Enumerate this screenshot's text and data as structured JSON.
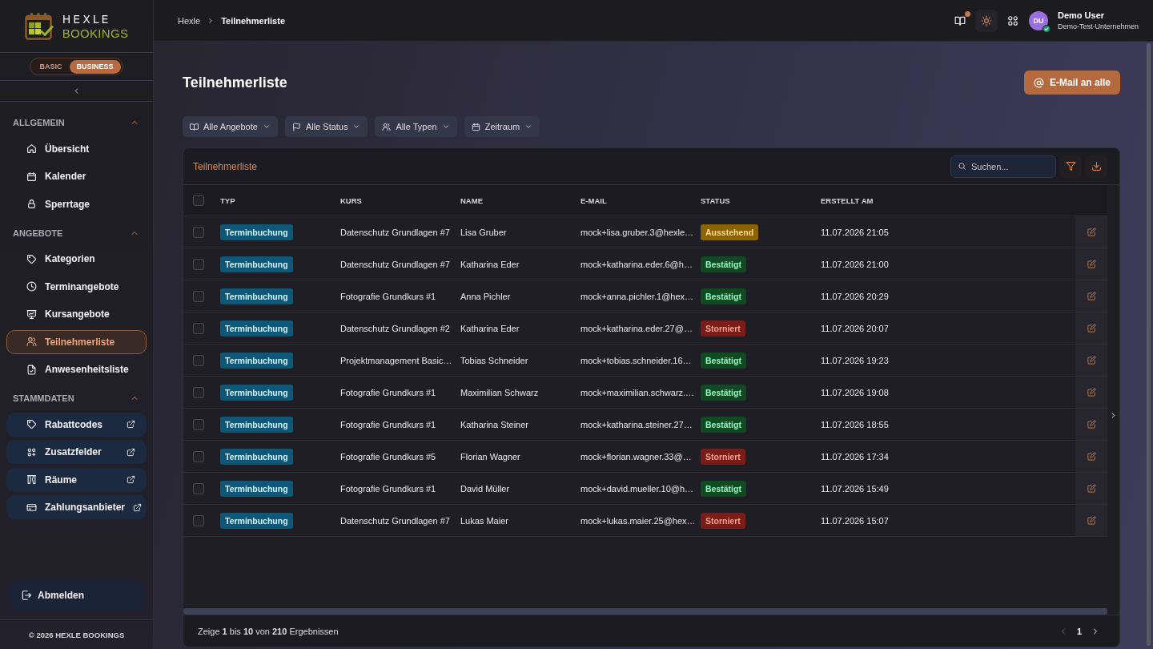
{
  "sidebar": {
    "logo": {
      "name": "HEXLE",
      "subtitle": "BOOKINGS"
    },
    "plans": [
      {
        "label": "BASIC",
        "selected": false
      },
      {
        "label": "BUSINESS",
        "selected": true
      }
    ],
    "sections": [
      {
        "title": "ALLGEMEIN",
        "expanded": true,
        "items": [
          {
            "label": "Übersicht",
            "kind": "page",
            "selected": false
          },
          {
            "label": "Kalender",
            "kind": "page",
            "selected": false
          },
          {
            "label": "Sperrtage",
            "kind": "page",
            "selected": false
          }
        ]
      },
      {
        "title": "ANGEBOTE",
        "expanded": true,
        "items": [
          {
            "label": "Kategorien",
            "kind": "page",
            "selected": false
          },
          {
            "label": "Terminangebote",
            "kind": "page",
            "selected": false
          },
          {
            "label": "Kursangebote",
            "kind": "page",
            "selected": false
          },
          {
            "label": "Teilnehmerliste",
            "kind": "page",
            "selected": true
          },
          {
            "label": "Anwesenheitsliste",
            "kind": "page",
            "selected": false
          }
        ]
      },
      {
        "title": "STAMMDATEN",
        "expanded": true,
        "items": [
          {
            "label": "Rabattcodes",
            "kind": "external",
            "selected": false
          },
          {
            "label": "Zusatzfelder",
            "kind": "external",
            "selected": false
          },
          {
            "label": "Räume",
            "kind": "external",
            "selected": false
          },
          {
            "label": "Zahlungsanbieter",
            "kind": "external",
            "selected": false
          }
        ]
      }
    ],
    "logout": "Abmelden",
    "copyright": "© 2026 HEXLE BOOKINGS"
  },
  "topbar": {
    "breadcrumb": [
      {
        "label": "Hexle",
        "current": false
      },
      {
        "label": "Teilnehmerliste",
        "current": true
      }
    ],
    "docs_badge": true,
    "theme_active": true,
    "user": {
      "initials": "DU",
      "name": "Demo User",
      "company": "Demo-Test-Unternehmen",
      "verified": true
    }
  },
  "page": {
    "title": "Teilnehmerliste",
    "action": "E-Mail an alle",
    "filters": [
      {
        "label": "Alle Angebote"
      },
      {
        "label": "Alle Status"
      },
      {
        "label": "Alle Typen"
      },
      {
        "label": "Zeitraum"
      }
    ]
  },
  "table": {
    "title": "Teilnehmerliste",
    "search": {
      "placeholder": "Suchen..."
    },
    "all_checked": false,
    "columns": [
      "TYP",
      "KURS",
      "NAME",
      "E-MAIL",
      "STATUS",
      "ERSTELLT AM"
    ],
    "rows": [
      {
        "checked": false,
        "type": "Terminbuchung",
        "course": "Datenschutz Grundlagen #7",
        "name": "Lisa Gruber",
        "email": "mock+lisa.gruber.3@hexle…",
        "status": {
          "label": "Ausstehend",
          "color": "#8d6300"
        },
        "created": "11.07.2026 21:05"
      },
      {
        "checked": false,
        "type": "Terminbuchung",
        "course": "Datenschutz Grundlagen #7",
        "name": "Katharina Eder",
        "email": "mock+katharina.eder.6@h…",
        "status": {
          "label": "Bestätigt",
          "color": "#0f4a25"
        },
        "created": "11.07.2026 21:00"
      },
      {
        "checked": false,
        "type": "Terminbuchung",
        "course": "Fotografie Grundkurs #1",
        "name": "Anna Pichler",
        "email": "mock+anna.pichler.1@hex…",
        "status": {
          "label": "Bestätigt",
          "color": "#0f4a25"
        },
        "created": "11.07.2026 20:29"
      },
      {
        "checked": false,
        "type": "Terminbuchung",
        "course": "Datenschutz Grundlagen #2",
        "name": "Katharina Eder",
        "email": "mock+katharina.eder.27@…",
        "status": {
          "label": "Storniert",
          "color": "#7b1c16"
        },
        "created": "11.07.2026 20:07"
      },
      {
        "checked": false,
        "type": "Terminbuchung",
        "course": "Projektmanagement Basic…",
        "name": "Tobias Schneider",
        "email": "mock+tobias.schneider.16…",
        "status": {
          "label": "Bestätigt",
          "color": "#0f4a25"
        },
        "created": "11.07.2026 19:23"
      },
      {
        "checked": false,
        "type": "Terminbuchung",
        "course": "Fotografie Grundkurs #1",
        "name": "Maximilian Schwarz",
        "email": "mock+maximilian.schwarz.…",
        "status": {
          "label": "Bestätigt",
          "color": "#0f4a25"
        },
        "created": "11.07.2026 19:08"
      },
      {
        "checked": false,
        "type": "Terminbuchung",
        "course": "Fotografie Grundkurs #1",
        "name": "Katharina Steiner",
        "email": "mock+katharina.steiner.27…",
        "status": {
          "label": "Bestätigt",
          "color": "#0f4a25"
        },
        "created": "11.07.2026 18:55"
      },
      {
        "checked": false,
        "type": "Terminbuchung",
        "course": "Fotografie Grundkurs #5",
        "name": "Florian Wagner",
        "email": "mock+florian.wagner.33@…",
        "status": {
          "label": "Storniert",
          "color": "#7b1c16"
        },
        "created": "11.07.2026 17:34"
      },
      {
        "checked": false,
        "type": "Terminbuchung",
        "course": "Fotografie Grundkurs #1",
        "name": "David Müller",
        "email": "mock+david.mueller.10@h…",
        "status": {
          "label": "Bestätigt",
          "color": "#0f4a25"
        },
        "created": "11.07.2026 15:49"
      },
      {
        "checked": false,
        "type": "Terminbuchung",
        "course": "Datenschutz Grundlagen #7",
        "name": "Lukas Maier",
        "email": "mock+lukas.maier.25@hex…",
        "status": {
          "label": "Storniert",
          "color": "#7b1c16"
        },
        "created": "11.07.2026 15:07"
      }
    ],
    "summary": "Zeige **1** bis **10** von **210** Ergebnissen",
    "pagination": {
      "prev_disabled": true,
      "pages": [
        {
          "label": "1",
          "selected": true
        }
      ],
      "next_disabled": false
    }
  }
}
